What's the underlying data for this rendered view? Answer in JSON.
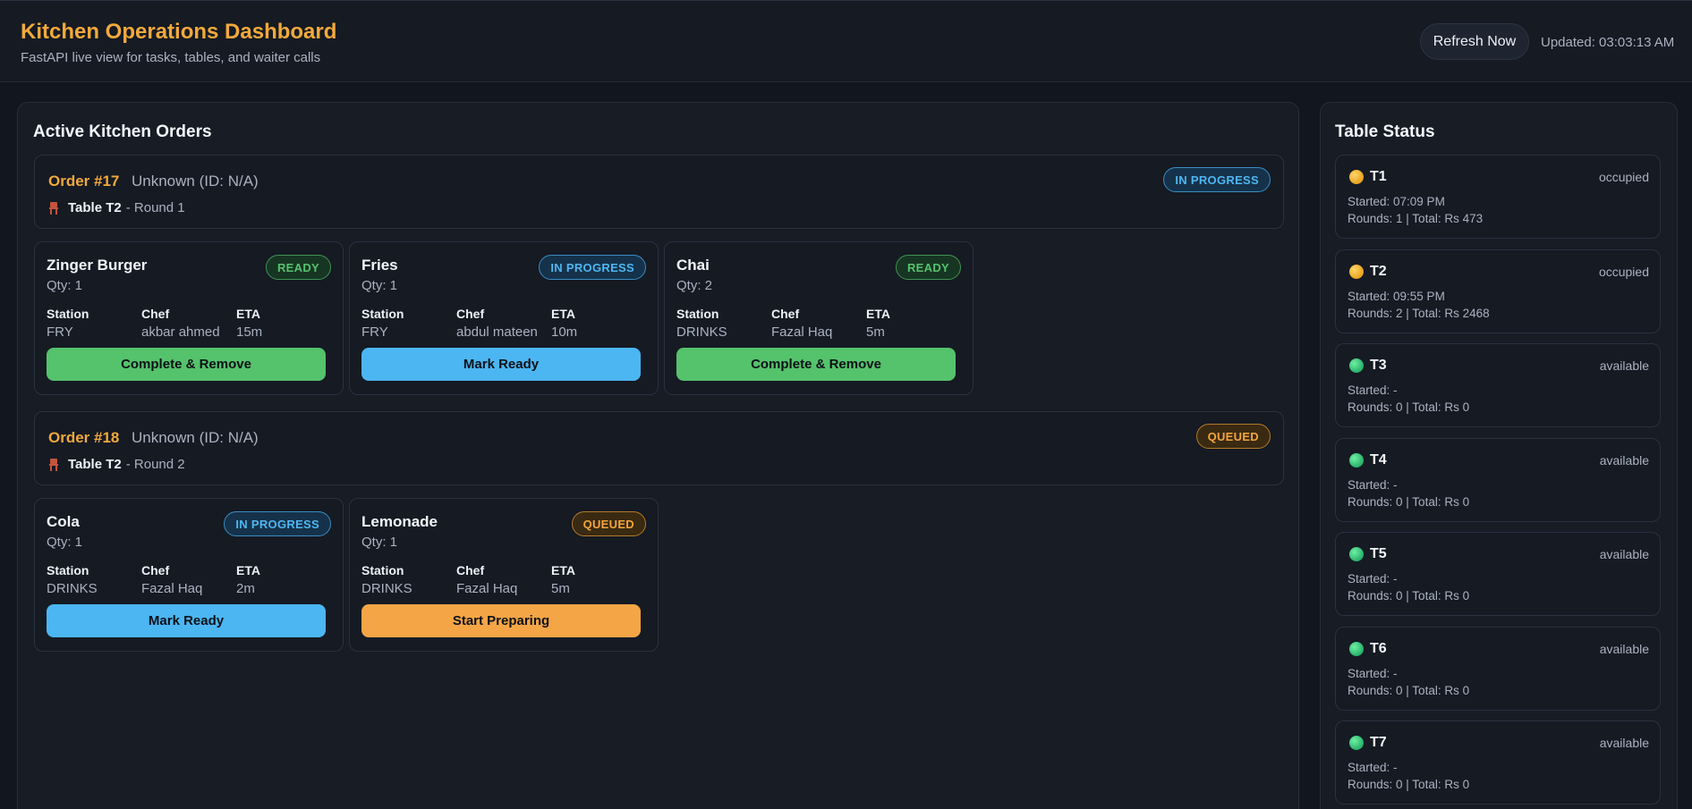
{
  "header": {
    "title": "Kitchen Operations Dashboard",
    "subtitle": "FastAPI live view for tasks, tables, and waiter calls",
    "refresh_label": "Refresh Now",
    "updated_text": "Updated: 03:03:13 AM"
  },
  "orders_panel": {
    "title": "Active Kitchen Orders",
    "orders": [
      {
        "number": "Order #17",
        "customer": "Unknown (ID: N/A)",
        "table": "Table T2",
        "round": "- Round 1",
        "status": "IN PROGRESS",
        "items": [
          {
            "name": "Zinger Burger",
            "qty": "Qty: 1",
            "status": "READY",
            "station_label": "Station",
            "station": "FRY",
            "chef_label": "Chef",
            "chef": "akbar ahmed",
            "eta_label": "ETA",
            "eta": "15m",
            "action": "Complete & Remove"
          },
          {
            "name": "Fries",
            "qty": "Qty: 1",
            "status": "IN PROGRESS",
            "station_label": "Station",
            "station": "FRY",
            "chef_label": "Chef",
            "chef": "abdul mateen",
            "eta_label": "ETA",
            "eta": "10m",
            "action": "Mark Ready"
          },
          {
            "name": "Chai",
            "qty": "Qty: 2",
            "status": "READY",
            "station_label": "Station",
            "station": "DRINKS",
            "chef_label": "Chef",
            "chef": "Fazal Haq",
            "eta_label": "ETA",
            "eta": "5m",
            "action": "Complete & Remove"
          }
        ]
      },
      {
        "number": "Order #18",
        "customer": "Unknown (ID: N/A)",
        "table": "Table T2",
        "round": "- Round 2",
        "status": "QUEUED",
        "items": [
          {
            "name": "Cola",
            "qty": "Qty: 1",
            "status": "IN PROGRESS",
            "station_label": "Station",
            "station": "DRINKS",
            "chef_label": "Chef",
            "chef": "Fazal Haq",
            "eta_label": "ETA",
            "eta": "2m",
            "action": "Mark Ready"
          },
          {
            "name": "Lemonade",
            "qty": "Qty: 1",
            "status": "QUEUED",
            "station_label": "Station",
            "station": "DRINKS",
            "chef_label": "Chef",
            "chef": "Fazal Haq",
            "eta_label": "ETA",
            "eta": "5m",
            "action": "Start Preparing"
          }
        ]
      }
    ]
  },
  "tables_panel": {
    "title": "Table Status",
    "tables": [
      {
        "name": "T1",
        "status": "occupied",
        "started": "Started: 07:09 PM",
        "rounds": "Rounds: 1 | Total: Rs 473"
      },
      {
        "name": "T2",
        "status": "occupied",
        "started": "Started: 09:55 PM",
        "rounds": "Rounds: 2 | Total: Rs 2468"
      },
      {
        "name": "T3",
        "status": "available",
        "started": "Started: -",
        "rounds": "Rounds: 0 | Total: Rs 0"
      },
      {
        "name": "T4",
        "status": "available",
        "started": "Started: -",
        "rounds": "Rounds: 0 | Total: Rs 0"
      },
      {
        "name": "T5",
        "status": "available",
        "started": "Started: -",
        "rounds": "Rounds: 0 | Total: Rs 0"
      },
      {
        "name": "T6",
        "status": "available",
        "started": "Started: -",
        "rounds": "Rounds: 0 | Total: Rs 0"
      },
      {
        "name": "T7",
        "status": "available",
        "started": "Started: -",
        "rounds": "Rounds: 0 | Total: Rs 0"
      }
    ]
  },
  "colors": {
    "accent": "#f2a93b",
    "ready": "#55c26c",
    "in_progress": "#4cb6f3",
    "queued": "#f4a546",
    "background": "#12161e"
  },
  "icons": {
    "table_chair": "chair-icon",
    "occupied_dot": "status-dot-occupied-icon",
    "available_dot": "status-dot-available-icon"
  }
}
